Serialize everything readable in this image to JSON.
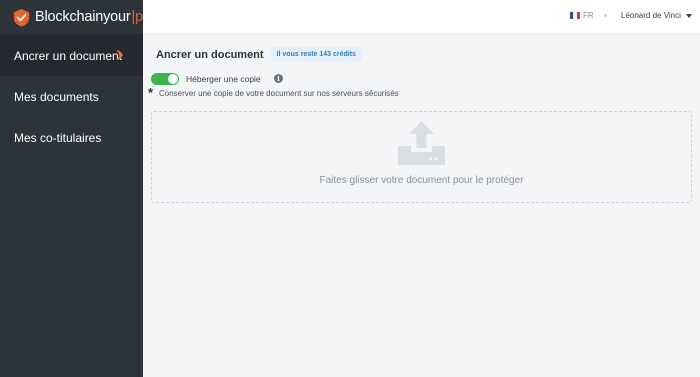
{
  "brand": {
    "name_part1": "Blockchainyour",
    "separator": "|",
    "name_part2": "p"
  },
  "sidebar": {
    "items": [
      {
        "label": "Ancrer un document",
        "active": true
      },
      {
        "label": "Mes documents",
        "active": false
      },
      {
        "label": "Mes co-titulaires",
        "active": false
      }
    ]
  },
  "topbar": {
    "language": "FR",
    "user_name": "Léonard de Vinci"
  },
  "main": {
    "title": "Ancrer un document",
    "credits_badge": "Il vous reste 143 crédits",
    "toggle": {
      "label": "Héberger une copie",
      "on": true
    },
    "note": "Conserver une copie de votre document sur nos serveurs sécurisés",
    "dropzone_text": "Faites glisser votre document pour le protéger"
  },
  "colors": {
    "sidebar_bg": "#2c3339",
    "accent_orange": "#e8632b",
    "toggle_green": "#39b54a",
    "badge_blue": "#2d7fc4"
  },
  "icons": [
    "shield-check-icon",
    "chevron-right-icon",
    "france-flag-icon",
    "caret-down-icon",
    "info-icon",
    "asterisk-icon",
    "upload-tray-icon"
  ]
}
